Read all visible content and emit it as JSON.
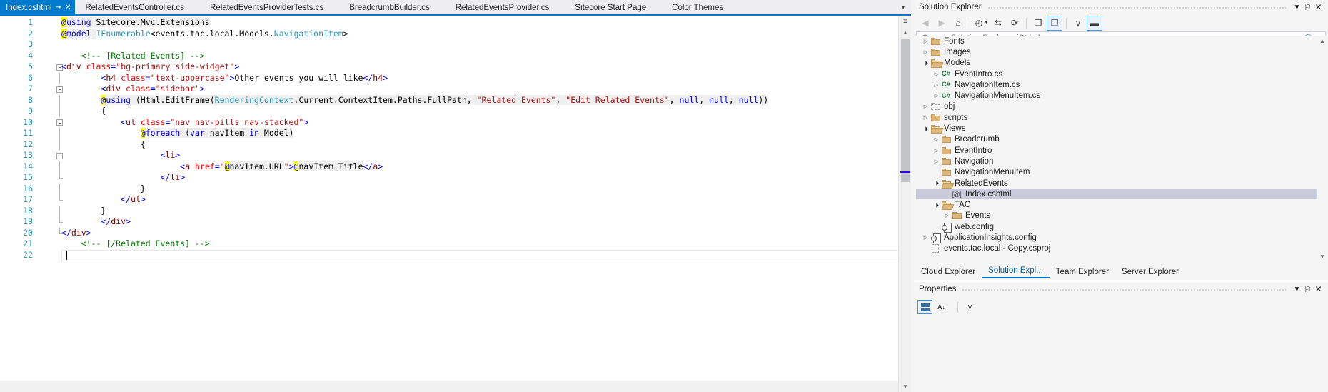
{
  "window": {
    "accent_color": "#007acc",
    "chrome_color": "#f5f5f5"
  },
  "tabs": [
    {
      "label": "Index.cshtml",
      "active": true,
      "pin": "⇥",
      "close": "✕"
    },
    {
      "label": "RelatedEventsController.cs",
      "active": false
    },
    {
      "label": "RelatedEventsProviderTests.cs",
      "active": false
    },
    {
      "label": "BreadcrumbBuilder.cs",
      "active": false
    },
    {
      "label": "RelatedEventsProvider.cs",
      "active": false
    },
    {
      "label": "Sitecore Start Page",
      "active": false
    },
    {
      "label": "Color Themes",
      "active": false
    }
  ],
  "tabbar": {
    "overflow_icon": "▼"
  },
  "editor": {
    "language": "cshtml",
    "caret_line": 22,
    "caret_column": 2,
    "lines": [
      {
        "n": "1",
        "indent": 0,
        "outline": "none",
        "tokens": [
          {
            "t": "@",
            "c": "at"
          },
          {
            "t": "using",
            "c": "k",
            "hl": true
          },
          {
            "t": " Sitecore.Mvc.Extensions",
            "c": "pl",
            "hl": true
          }
        ]
      },
      {
        "n": "2",
        "indent": 0,
        "outline": "none",
        "tokens": [
          {
            "t": "@",
            "c": "at"
          },
          {
            "t": "model",
            "c": "k",
            "hl": true
          },
          {
            "t": " ",
            "c": "pl",
            "hl": true
          },
          {
            "t": "IEnumerable",
            "c": "ty"
          },
          {
            "t": "<events.tac.local.Models.",
            "c": "pl"
          },
          {
            "t": "NavigationItem",
            "c": "ty"
          },
          {
            "t": ">",
            "c": "pl"
          }
        ]
      },
      {
        "n": "3",
        "indent": 0,
        "outline": "none",
        "tokens": []
      },
      {
        "n": "4",
        "indent": 1,
        "outline": "none",
        "tokens": [
          {
            "t": "<!-- [Related Events] -->",
            "c": "cm"
          }
        ]
      },
      {
        "n": "5",
        "indent": 0,
        "outline": "box",
        "tokens": [
          {
            "t": "<",
            "c": "k"
          },
          {
            "t": "div",
            "c": "tg"
          },
          {
            "t": " ",
            "c": "pl"
          },
          {
            "t": "class",
            "c": "an"
          },
          {
            "t": "=",
            "c": "k"
          },
          {
            "t": "\"bg-primary side-widget\"",
            "c": "st"
          },
          {
            "t": ">",
            "c": "k"
          }
        ]
      },
      {
        "n": "6",
        "indent": 2,
        "outline": "vline",
        "tokens": [
          {
            "t": "<",
            "c": "k"
          },
          {
            "t": "h4",
            "c": "tg"
          },
          {
            "t": " ",
            "c": "pl"
          },
          {
            "t": "class",
            "c": "an"
          },
          {
            "t": "=",
            "c": "k"
          },
          {
            "t": "\"text-uppercase\"",
            "c": "st"
          },
          {
            "t": ">",
            "c": "k"
          },
          {
            "t": "Other events you will like",
            "c": "pl"
          },
          {
            "t": "</",
            "c": "k"
          },
          {
            "t": "h4",
            "c": "tg"
          },
          {
            "t": ">",
            "c": "k"
          }
        ]
      },
      {
        "n": "7",
        "indent": 2,
        "outline": "box-nested",
        "tokens": [
          {
            "t": "<",
            "c": "k"
          },
          {
            "t": "div",
            "c": "tg"
          },
          {
            "t": " ",
            "c": "pl"
          },
          {
            "t": "class",
            "c": "an"
          },
          {
            "t": "=",
            "c": "k"
          },
          {
            "t": "\"sidebar\"",
            "c": "st"
          },
          {
            "t": ">",
            "c": "k"
          }
        ]
      },
      {
        "n": "8",
        "indent": 2,
        "outline": "vline",
        "razor": true,
        "tokens": [
          {
            "t": "@",
            "c": "at"
          },
          {
            "t": "using",
            "c": "k",
            "hl": true
          },
          {
            "t": " (Html.EditFrame(",
            "c": "pl",
            "hl": true
          },
          {
            "t": "RenderingContext",
            "c": "ty",
            "hl": true
          },
          {
            "t": ".Current.ContextItem.Paths.FullPath, ",
            "c": "pl",
            "hl": true
          },
          {
            "t": "\"Related Events\"",
            "c": "st",
            "hl": true
          },
          {
            "t": ", ",
            "c": "pl",
            "hl": true
          },
          {
            "t": "\"Edit Related Events\"",
            "c": "st",
            "hl": true
          },
          {
            "t": ", ",
            "c": "pl",
            "hl": true
          },
          {
            "t": "null",
            "c": "k",
            "hl": true
          },
          {
            "t": ", ",
            "c": "pl",
            "hl": true
          },
          {
            "t": "null",
            "c": "k",
            "hl": true
          },
          {
            "t": ", ",
            "c": "pl",
            "hl": true
          },
          {
            "t": "null",
            "c": "k",
            "hl": true
          },
          {
            "t": "))",
            "c": "pl",
            "hl": true
          }
        ]
      },
      {
        "n": "9",
        "indent": 2,
        "outline": "vline",
        "tokens": [
          {
            "t": "{",
            "c": "pl"
          }
        ]
      },
      {
        "n": "10",
        "indent": 3,
        "outline": "box-nested",
        "tokens": [
          {
            "t": "<",
            "c": "k"
          },
          {
            "t": "ul",
            "c": "tg"
          },
          {
            "t": " ",
            "c": "pl"
          },
          {
            "t": "class",
            "c": "an"
          },
          {
            "t": "=",
            "c": "k"
          },
          {
            "t": "\"nav nav-pills nav-stacked\"",
            "c": "st"
          },
          {
            "t": ">",
            "c": "k"
          }
        ]
      },
      {
        "n": "11",
        "indent": 4,
        "outline": "vline",
        "razor": true,
        "tokens": [
          {
            "t": "@",
            "c": "at"
          },
          {
            "t": "foreach",
            "c": "k",
            "hl": true
          },
          {
            "t": " (",
            "c": "pl",
            "hl": true
          },
          {
            "t": "var",
            "c": "k",
            "hl": true
          },
          {
            "t": " navItem ",
            "c": "pl",
            "hl": true
          },
          {
            "t": "in",
            "c": "k",
            "hl": true
          },
          {
            "t": " Model)",
            "c": "pl",
            "hl": true
          }
        ]
      },
      {
        "n": "12",
        "indent": 4,
        "outline": "vline",
        "tokens": [
          {
            "t": "{",
            "c": "pl"
          }
        ]
      },
      {
        "n": "13",
        "indent": 5,
        "outline": "box-nested",
        "tokens": [
          {
            "t": "<",
            "c": "k"
          },
          {
            "t": "li",
            "c": "tg"
          },
          {
            "t": ">",
            "c": "k"
          }
        ]
      },
      {
        "n": "14",
        "indent": 6,
        "outline": "vline",
        "tokens": [
          {
            "t": "<",
            "c": "k"
          },
          {
            "t": "a",
            "c": "tg"
          },
          {
            "t": " ",
            "c": "pl"
          },
          {
            "t": "href",
            "c": "an"
          },
          {
            "t": "=",
            "c": "k"
          },
          {
            "t": "\"",
            "c": "st"
          },
          {
            "t": "@",
            "c": "at"
          },
          {
            "t": "navItem.URL",
            "c": "pl",
            "hl": true
          },
          {
            "t": "\"",
            "c": "st"
          },
          {
            "t": ">",
            "c": "k"
          },
          {
            "t": "@",
            "c": "at"
          },
          {
            "t": "navItem.Title",
            "c": "pl",
            "hl": true
          },
          {
            "t": "</",
            "c": "k"
          },
          {
            "t": "a",
            "c": "tg"
          },
          {
            "t": ">",
            "c": "k"
          }
        ]
      },
      {
        "n": "15",
        "indent": 5,
        "outline": "vline-end",
        "tokens": [
          {
            "t": "</",
            "c": "k"
          },
          {
            "t": "li",
            "c": "tg"
          },
          {
            "t": ">",
            "c": "k"
          }
        ]
      },
      {
        "n": "16",
        "indent": 4,
        "outline": "vline",
        "tokens": [
          {
            "t": "}",
            "c": "pl"
          }
        ]
      },
      {
        "n": "17",
        "indent": 3,
        "outline": "vline-end",
        "tokens": [
          {
            "t": "</",
            "c": "k"
          },
          {
            "t": "ul",
            "c": "tg"
          },
          {
            "t": ">",
            "c": "k"
          }
        ]
      },
      {
        "n": "18",
        "indent": 2,
        "outline": "vline",
        "tokens": [
          {
            "t": "}",
            "c": "pl"
          }
        ]
      },
      {
        "n": "19",
        "indent": 2,
        "outline": "vline-end",
        "tokens": [
          {
            "t": "</",
            "c": "k"
          },
          {
            "t": "div",
            "c": "tg"
          },
          {
            "t": ">",
            "c": "k"
          }
        ]
      },
      {
        "n": "20",
        "indent": 0,
        "outline": "vline-end",
        "tokens": [
          {
            "t": "</",
            "c": "k"
          },
          {
            "t": "div",
            "c": "tg"
          },
          {
            "t": ">",
            "c": "k"
          }
        ]
      },
      {
        "n": "21",
        "indent": 1,
        "outline": "none",
        "tokens": [
          {
            "t": "<!-- [/Related Events] -->",
            "c": "cm"
          }
        ]
      },
      {
        "n": "22",
        "indent": 1,
        "outline": "none",
        "tokens": []
      }
    ]
  },
  "editor_scrollbar": {
    "split_icon": "≡",
    "up_icon": "▲",
    "down_icon": "▼"
  },
  "solution_explorer": {
    "title": "Solution Explorer",
    "pin_icon": "⚐",
    "close_icon": "✕",
    "dropdown_icon": "▼",
    "toolbar": [
      {
        "name": "back-button",
        "glyph": "◀",
        "disabled": true
      },
      {
        "name": "forward-button",
        "glyph": "▶",
        "disabled": true
      },
      {
        "name": "home-button",
        "glyph": "⌂",
        "disabled": false
      },
      {
        "name": "pending-changes-button",
        "glyph": "◴",
        "disabled": false
      },
      {
        "name": "sync-with-active-document-button",
        "glyph": "⇆",
        "disabled": false
      },
      {
        "name": "refresh-button",
        "glyph": "⟳",
        "disabled": false
      },
      {
        "name": "collapse-all-button",
        "glyph": "❐",
        "disabled": false
      },
      {
        "name": "show-all-files-button",
        "glyph": "❐",
        "boxed": true
      },
      {
        "name": "properties-button",
        "glyph": "ᴠ",
        "disabled": false
      },
      {
        "name": "preview-selected-items-button",
        "glyph": "▬",
        "boxed": true
      }
    ],
    "search": {
      "placeholder": "Search Solution Explorer (Ctrl+;)",
      "value": "",
      "magnifier_icon": "⚲",
      "dropdown_icon": "▼"
    },
    "tree": [
      {
        "label": "Fonts",
        "depth": 1,
        "twisty": "collapsed",
        "icon": "folder"
      },
      {
        "label": "Images",
        "depth": 1,
        "twisty": "collapsed",
        "icon": "folder"
      },
      {
        "label": "Models",
        "depth": 1,
        "twisty": "expanded",
        "icon": "folder-open"
      },
      {
        "label": "EventIntro.cs",
        "depth": 2,
        "twisty": "collapsed",
        "icon": "csharp"
      },
      {
        "label": "NavigationItem.cs",
        "depth": 2,
        "twisty": "collapsed",
        "icon": "csharp"
      },
      {
        "label": "NavigationMenuItem.cs",
        "depth": 2,
        "twisty": "collapsed",
        "icon": "csharp"
      },
      {
        "label": "obj",
        "depth": 1,
        "twisty": "collapsed",
        "icon": "folder-dashed"
      },
      {
        "label": "scripts",
        "depth": 1,
        "twisty": "collapsed",
        "icon": "folder"
      },
      {
        "label": "Views",
        "depth": 1,
        "twisty": "expanded",
        "icon": "folder-open"
      },
      {
        "label": "Breadcrumb",
        "depth": 2,
        "twisty": "collapsed",
        "icon": "folder"
      },
      {
        "label": "EventIntro",
        "depth": 2,
        "twisty": "collapsed",
        "icon": "folder"
      },
      {
        "label": "Navigation",
        "depth": 2,
        "twisty": "collapsed",
        "icon": "folder"
      },
      {
        "label": "NavigationMenuItem",
        "depth": 2,
        "twisty": "none",
        "icon": "folder"
      },
      {
        "label": "RelatedEvents",
        "depth": 2,
        "twisty": "expanded",
        "icon": "folder-open"
      },
      {
        "label": "Index.cshtml",
        "depth": 3,
        "twisty": "none",
        "icon": "cshtml",
        "selected": true
      },
      {
        "label": "TAC",
        "depth": 2,
        "twisty": "expanded",
        "icon": "folder-open"
      },
      {
        "label": "Events",
        "depth": 3,
        "twisty": "collapsed",
        "icon": "folder"
      },
      {
        "label": "web.config",
        "depth": 2,
        "twisty": "none",
        "icon": "config"
      },
      {
        "label": "ApplicationInsights.config",
        "depth": 1,
        "twisty": "collapsed",
        "icon": "config"
      },
      {
        "label": "events.tac.local - Copy.csproj",
        "depth": 1,
        "twisty": "none",
        "icon": "csproj"
      }
    ],
    "scrollbar": {
      "up_icon": "▲",
      "down_icon": "▼"
    },
    "bottom_tabs": [
      {
        "label": "Cloud Explorer",
        "active": false
      },
      {
        "label": "Solution Expl...",
        "active": true
      },
      {
        "label": "Team Explorer",
        "active": false
      },
      {
        "label": "Server Explorer",
        "active": false
      }
    ]
  },
  "properties": {
    "title": "Properties",
    "pin_icon": "⚐",
    "close_icon": "✕",
    "dropdown_icon": "▼",
    "toolbar": [
      {
        "name": "categorized-button",
        "glyph": "grid",
        "boxed": true
      },
      {
        "name": "alphabetical-button",
        "glyph": "A↓",
        "boxed": false
      },
      {
        "name": "property-pages-button",
        "glyph": "ᴠ",
        "boxed": false
      }
    ]
  }
}
